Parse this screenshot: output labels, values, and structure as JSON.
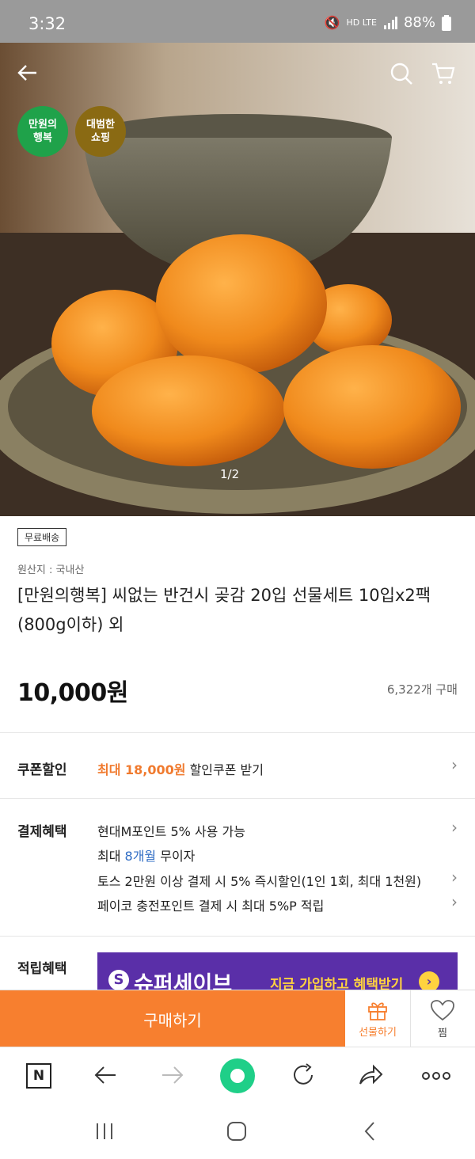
{
  "status_bar": {
    "time": "3:32",
    "signal": "HD LTE",
    "battery": "88%"
  },
  "hero": {
    "badges": [
      "만원의\n행복",
      "대범한\n쇼핑"
    ],
    "counter": "1/2"
  },
  "product": {
    "tag": "무료배송",
    "origin": "원산지 : 국내산",
    "title": "[만원의행복] 씨없는 반건시 곶감 20입 선물세트 10입x2팩(800g이하) 외",
    "price": "10,000원",
    "sold": "6,322개 구매"
  },
  "coupon": {
    "label": "쿠폰할인",
    "highlight": "최대 18,000원",
    "text": " 할인쿠폰 받기"
  },
  "payment": {
    "label": "결제혜택",
    "row1": "현대M포인트 5% 사용 가능",
    "row2_pre": "최대 ",
    "row2_hl": "8개월",
    "row2_post": " 무이자",
    "row3": "토스 2만원 이상 결제 시 5% 즉시할인(1인 1회, 최대 1천원)",
    "row4": "페이코 충전포인트 결제 시 최대 5%P 적립"
  },
  "reward": {
    "label": "적립혜택",
    "banner_brand": "슈퍼세이브",
    "banner_cta": "지금 가입하고 혜택받기"
  },
  "buy_bar": {
    "buy": "구매하기",
    "gift": "선물하기",
    "wish": "찜"
  },
  "browser_bar": {
    "home_letter": "N"
  },
  "colors": {
    "accent": "#f77f2f",
    "badge1": "#1fa24a",
    "badge2": "#8a6a13",
    "banner": "#5a2fa8"
  }
}
